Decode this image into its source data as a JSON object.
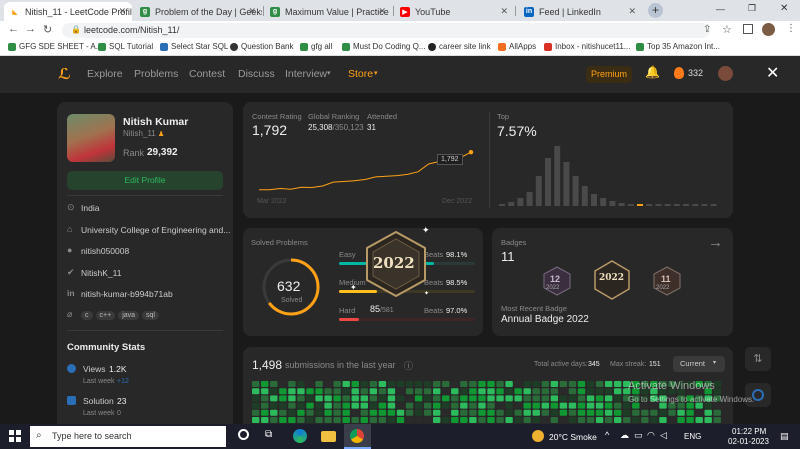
{
  "browser": {
    "tabs": [
      {
        "title": "Nitish_11 - LeetCode Profile",
        "icon": "leetcode-icon",
        "color": "#ffa116"
      },
      {
        "title": "Problem of the Day | GeeksforGeeks",
        "icon": "gfg-icon",
        "color": "#2f8d46"
      },
      {
        "title": "Maximum Value | Practice | GeeksforGeeks",
        "icon": "gfg-icon",
        "color": "#2f8d46"
      },
      {
        "title": "YouTube",
        "icon": "youtube-icon",
        "color": "#ff0000"
      },
      {
        "title": "Feed | LinkedIn",
        "icon": "linkedin-icon",
        "color": "#0a66c2"
      }
    ],
    "url": "leetcode.com/Nitish_11/",
    "bookmarks": [
      "GFG SDE SHEET - A...",
      "SQL Tutorial",
      "Select Star SQL",
      "Question Bank",
      "gfg all",
      "Must Do Coding Q...",
      "career site link",
      "AllApps",
      "Inbox - nitishucet11...",
      "Top 35 Amazon Int..."
    ]
  },
  "nav": {
    "items": [
      "Explore",
      "Problems",
      "Contest",
      "Discuss",
      "Interview",
      "Store"
    ],
    "premium": "Premium",
    "coins": "332"
  },
  "profile": {
    "name": "Nitish Kumar",
    "username": "Nitish_11",
    "rank_label": "Rank",
    "rank": "29,392",
    "edit_label": "Edit Profile",
    "location": "India",
    "school": "University College of Engineering and...",
    "github": "nitish050008",
    "twitter": "NitishK_11",
    "linkedin": "nitish-kumar-b994b71ab",
    "skills": [
      "c",
      "c++",
      "java",
      "sql"
    ]
  },
  "community": {
    "title": "Community Stats",
    "views_label": "Views",
    "views": "1.2K",
    "views_last_week": "Last week",
    "views_delta": "+12",
    "solution_label": "Solution",
    "solution": "23",
    "solution_last_week": "Last week",
    "solution_delta": "0"
  },
  "contest": {
    "rating_label": "Contest Rating",
    "rating": "1,792",
    "ranking_label": "Global Ranking",
    "ranking": "25,308",
    "ranking_total": "/350,123",
    "attended_label": "Attended",
    "attended": "31",
    "tooltip": "1,792",
    "x_start": "Mar 2022",
    "x_end": "Dec 2022",
    "top_label": "Top",
    "top_value": "7.57%"
  },
  "chart_data": [
    {
      "type": "line",
      "x": [
        "Mar 2022",
        "Dec 2022"
      ],
      "values": [
        1500,
        1500,
        1510,
        1505,
        1520,
        1518,
        1530,
        1560,
        1565,
        1570,
        1580,
        1600,
        1605,
        1610,
        1620,
        1640,
        1700,
        1720,
        1740,
        1750,
        1792
      ],
      "title": "",
      "xlabel": "",
      "ylabel": ""
    },
    {
      "type": "bar",
      "values": [
        2,
        4,
        8,
        14,
        30,
        48,
        60,
        44,
        30,
        20,
        12,
        8,
        5,
        3,
        2,
        1,
        1,
        1,
        1,
        1,
        1,
        1,
        1,
        1
      ],
      "highlight_index": 15,
      "title": "",
      "xlabel": "",
      "ylabel": ""
    }
  ],
  "solved": {
    "title": "Solved Problems",
    "total": "632",
    "total_label": "Solved",
    "easy_label": "Easy",
    "easy_beats": "Beats",
    "easy_pct": "98.1%",
    "medium_label": "Medium",
    "medium_beats": "Beats",
    "medium_pct": "98.5%",
    "hard_label": "Hard",
    "hard_count": "85",
    "hard_total": "/581",
    "hard_beats": "Beats",
    "hard_pct": "97.0%"
  },
  "badges": {
    "title": "Badges",
    "count": "11",
    "badge_year": "2022",
    "recent_label": "Most Recent Badge",
    "recent": "Annual Badge 2022"
  },
  "submissions": {
    "count": "1,498",
    "text": "submissions in the last year",
    "active_label": "Total active days:",
    "active": "345",
    "streak_label": "Max streak:",
    "streak": "151",
    "range": "Current"
  },
  "watermark": {
    "line1": "Activate Windows",
    "line2": "Go to Settings to activate Windows."
  },
  "taskbar": {
    "search": "Type here to search",
    "weather": "20°C  Smoke",
    "lang": "ENG",
    "time": "01:22 PM",
    "date": "02-01-2023"
  },
  "colors": {
    "accent": "#ffa116",
    "easy": "#00b8a3",
    "medium": "#ffc01e",
    "hard": "#ef4743",
    "green": "#2cbb5d"
  }
}
